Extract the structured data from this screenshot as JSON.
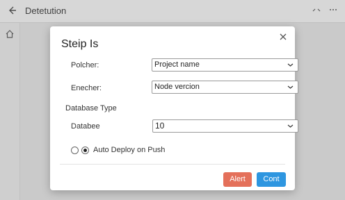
{
  "topbar": {
    "title": "Detetution",
    "back_icon": "back-arrow-icon",
    "actions": [
      "minimize-icon",
      "more-icon"
    ]
  },
  "sidebar": {
    "home_icon": "home-icon"
  },
  "dialog": {
    "title": "Steip Is",
    "close_icon": "close-icon",
    "fields": [
      {
        "label": "Polcher:",
        "value": "Project name"
      },
      {
        "label": "Enecher:",
        "value": "Node vercion"
      }
    ],
    "section_label": "Database  Type",
    "database": {
      "label": "Databee",
      "value": "10"
    },
    "radio": {
      "label": "Auto Deploy on Push",
      "selected": true
    },
    "buttons": {
      "alert": "Alert",
      "continue": "Cont"
    },
    "colors": {
      "alert_button": "#e4705a",
      "continue_button": "#2e96e0"
    }
  }
}
